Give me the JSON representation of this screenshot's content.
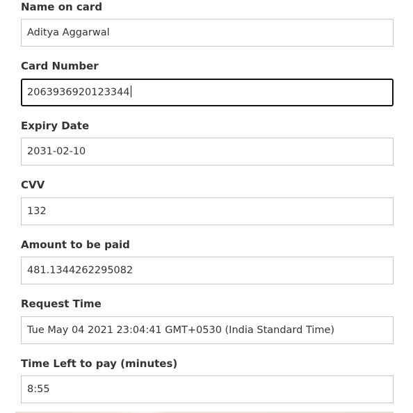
{
  "form": {
    "name_on_card": {
      "label": "Name on card",
      "value": "Aditya Aggarwal"
    },
    "card_number": {
      "label": "Card Number",
      "value": "2063936920123344"
    },
    "expiry_date": {
      "label": "Expiry Date",
      "value": "2031-02-10"
    },
    "cvv": {
      "label": "CVV",
      "value": "132"
    },
    "amount": {
      "label": "Amount to be paid",
      "value": "481.1344262295082"
    },
    "request_time": {
      "label": "Request Time",
      "value": "Tue May 04 2021 23:04:41 GMT+0530 (India Standard Time)"
    },
    "time_left": {
      "label": "Time Left to pay (minutes)",
      "value": "8:55"
    }
  }
}
